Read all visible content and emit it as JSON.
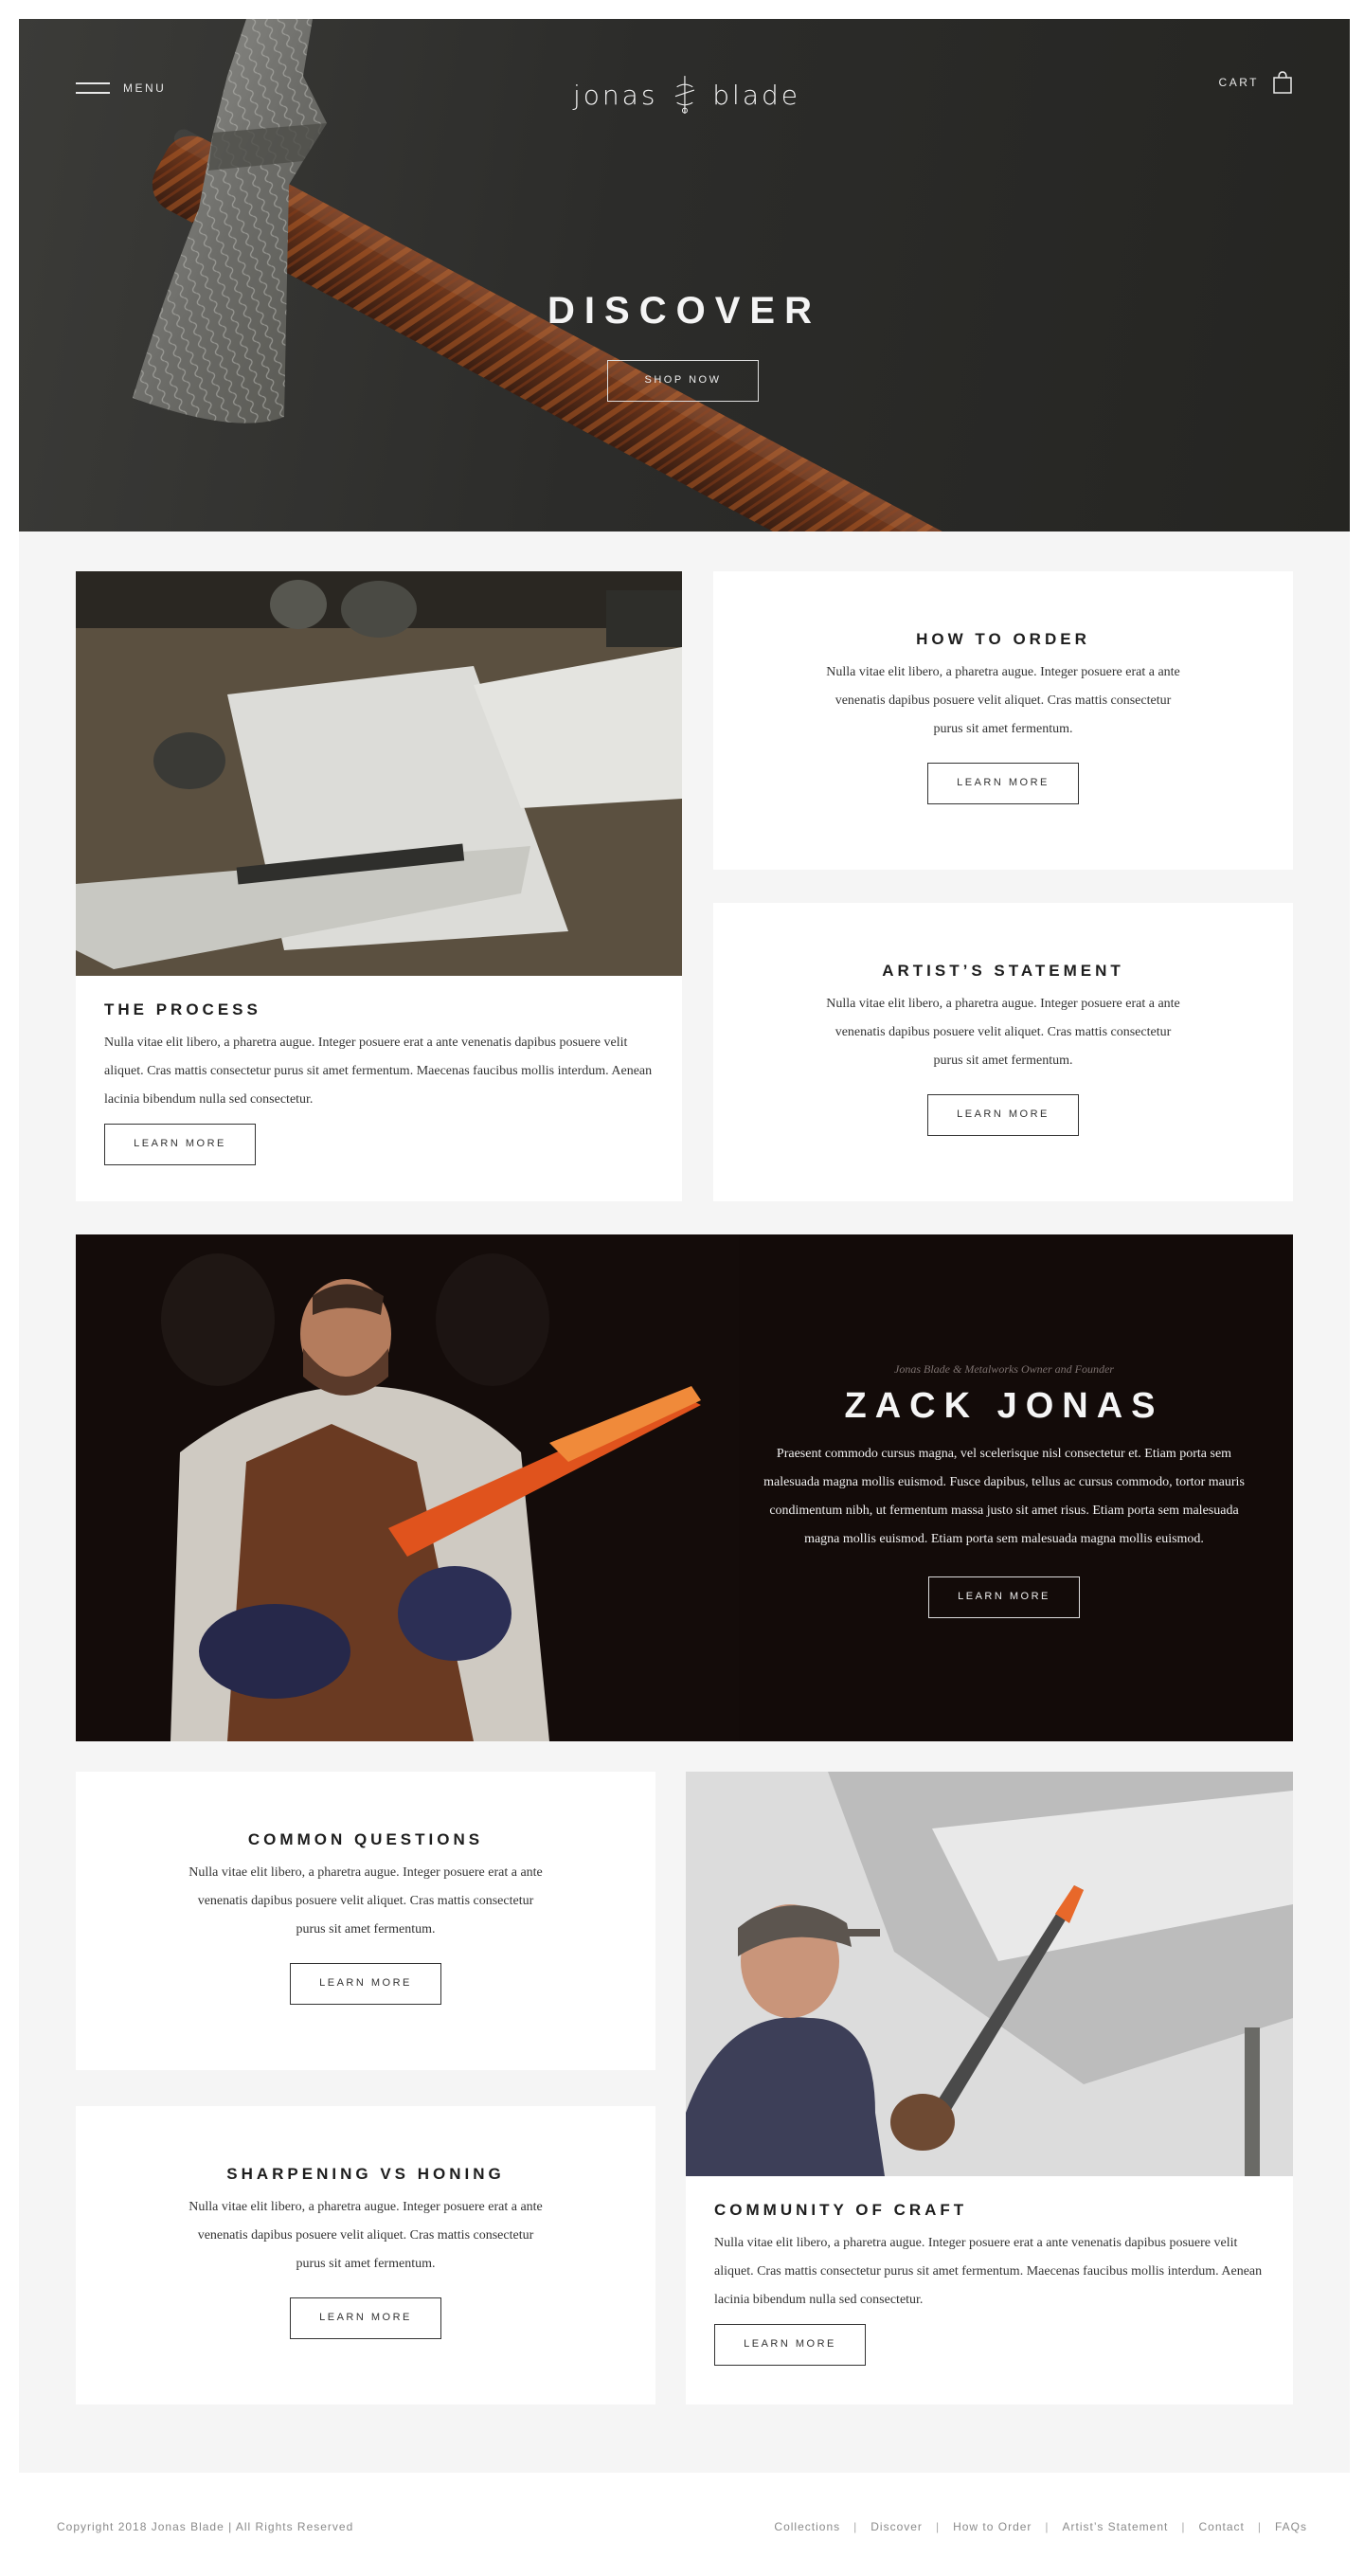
{
  "header": {
    "menu_label": "MENU",
    "logo_left": "jonas",
    "logo_right": "blade",
    "cart_label": "CART"
  },
  "hero": {
    "title": "DISCOVER",
    "button": "SHOP NOW"
  },
  "cards": {
    "process": {
      "title": "THE PROCESS",
      "text": "Nulla vitae elit libero, a pharetra augue. Integer posuere erat a ante venenatis dapibus posuere velit aliquet. Cras mattis consectetur purus sit amet fermentum. Maecenas faucibus mollis interdum. Aenean lacinia bibendum nulla sed consectetur.",
      "button": "LEARN MORE"
    },
    "order": {
      "title": "HOW TO ORDER",
      "text": "Nulla vitae elit libero, a pharetra augue. Integer posuere erat a ante venenatis dapibus posuere velit aliquet. Cras mattis consectetur purus sit amet fermentum.",
      "button": "LEARN MORE"
    },
    "statement": {
      "title": "ARTIST’S STATEMENT",
      "text": "Nulla vitae elit libero, a pharetra augue. Integer posuere erat a ante venenatis dapibus posuere velit aliquet. Cras mattis consectetur purus sit amet fermentum.",
      "button": "LEARN MORE"
    },
    "questions": {
      "title": "COMMON QUESTIONS",
      "text": "Nulla vitae elit libero, a pharetra augue. Integer posuere erat a ante venenatis dapibus posuere velit aliquet. Cras mattis consectetur purus sit amet fermentum.",
      "button": "LEARN MORE"
    },
    "sharpening": {
      "title": "SHARPENING VS HONING",
      "text": "Nulla vitae elit libero, a pharetra augue. Integer posuere erat a ante venenatis dapibus posuere velit aliquet. Cras mattis consectetur purus sit amet fermentum.",
      "button": "LEARN MORE"
    },
    "community": {
      "title": "COMMUNITY OF CRAFT",
      "text": "Nulla vitae elit libero, a pharetra augue. Integer posuere erat a ante venenatis dapibus posuere velit aliquet. Cras mattis consectetur purus sit amet fermentum. Maecenas faucibus mollis interdum. Aenean lacinia bibendum nulla sed consectetur.",
      "button": "LEARN MORE"
    }
  },
  "feature": {
    "subtitle": "Jonas Blade & Metalworks Owner and Founder",
    "name": "ZACK JONAS",
    "text": "Praesent commodo cursus magna, vel scelerisque nisl consectetur et. Etiam porta sem malesuada magna mollis euismod. Fusce dapibus, tellus ac cursus commodo, tortor mauris condimentum nibh, ut fermentum massa justo sit amet risus. Etiam porta sem malesuada magna mollis euismod. Etiam porta sem malesuada magna mollis euismod.",
    "button": "LEARN MORE"
  },
  "footer": {
    "copyright": "Copyright 2018 Jonas Blade | All Rights Reserved",
    "links": [
      "Collections",
      "Discover",
      "How to Order",
      "Artist’s Statement",
      "Contact",
      "FAQs"
    ],
    "separator": "|"
  },
  "icons": [
    "hamburger-icon",
    "logo-mark-icon",
    "shopping-bag-icon"
  ]
}
